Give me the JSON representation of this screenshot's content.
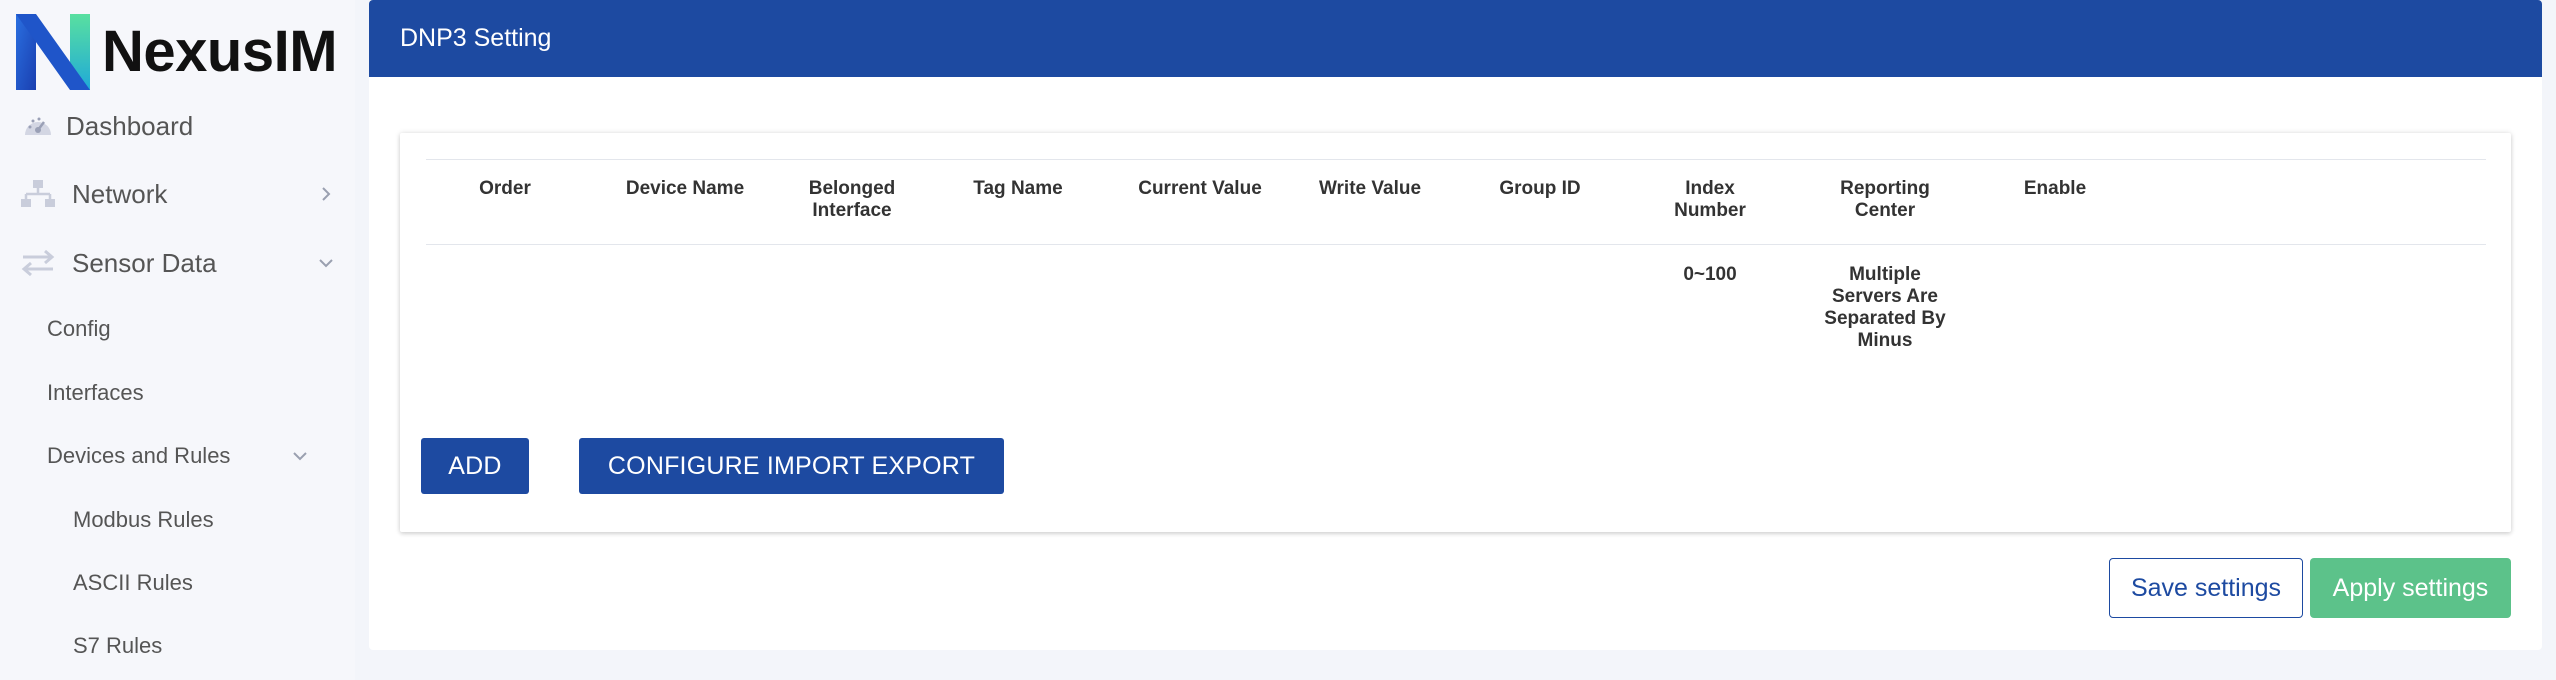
{
  "brand": {
    "name": "NexusIM"
  },
  "sidebar": {
    "items": [
      {
        "label": "Dashboard",
        "icon": "dashboard-gauge-icon"
      },
      {
        "label": "Network",
        "icon": "network-icon",
        "chevron": "chevron-right-icon"
      },
      {
        "label": "Sensor Data",
        "icon": "sensor-data-arrows-icon",
        "chevron": "chevron-down-icon"
      }
    ],
    "sub_items": [
      {
        "label": "Config"
      },
      {
        "label": "Interfaces"
      },
      {
        "label": "Devices and Rules",
        "chevron": "chevron-down-icon"
      }
    ],
    "rule_items": [
      {
        "label": "Modbus Rules"
      },
      {
        "label": "ASCII Rules"
      },
      {
        "label": "S7 Rules"
      }
    ]
  },
  "panel": {
    "title": "DNP3 Setting"
  },
  "table": {
    "columns": [
      "Order",
      "Device Name",
      "Belonged\nInterface",
      "Tag Name",
      "Current Value",
      "Write Value",
      "Group ID",
      "Index\nNumber",
      "Reporting\nCenter",
      "Enable"
    ],
    "hint_row": {
      "index_number": "0~100",
      "reporting_center": "Multiple\nServers Are\nSeparated By\nMinus"
    }
  },
  "buttons": {
    "add": "ADD",
    "configure_import_export": "CONFIGURE IMPORT EXPORT",
    "save": "Save settings",
    "apply": "Apply settings"
  },
  "colors": {
    "primary": "#1d4aa1",
    "apply_green": "#5cc28a",
    "sidebar_bg": "#f6f7fb"
  }
}
